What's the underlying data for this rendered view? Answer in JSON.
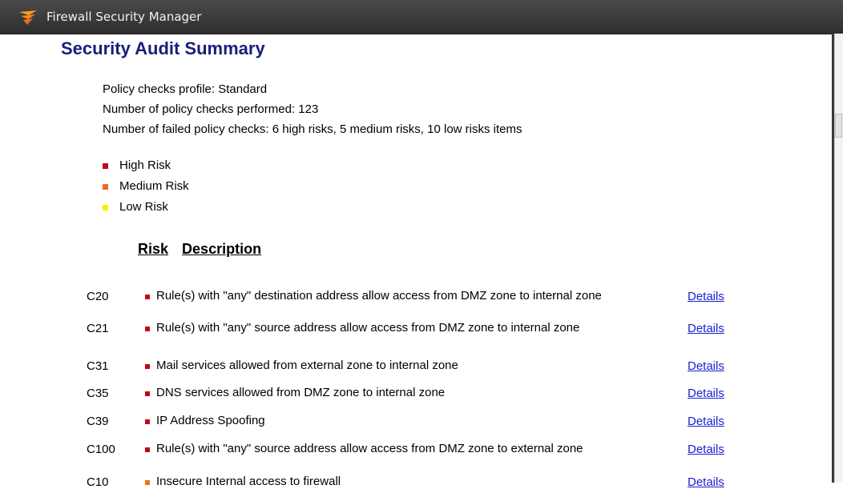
{
  "window": {
    "title": "Firewall Security Manager",
    "icon": "solarwinds-logo-icon"
  },
  "page": {
    "title": "Security Audit Summary"
  },
  "summary": {
    "profile": "Policy checks profile: Standard",
    "performed": "Number of policy checks performed: 123",
    "failed": "Number of failed policy checks: 6 high risks, 5 medium risks, 10 low risks items"
  },
  "legend": [
    {
      "label": "High Risk",
      "color": "#c0081b"
    },
    {
      "label": "Medium Risk",
      "color": "#f26b1d"
    },
    {
      "label": "Low Risk",
      "color": "#f5ef00"
    }
  ],
  "columns": {
    "risk": "Risk",
    "description": "Description"
  },
  "rows": [
    {
      "code": "C20",
      "desc": "Rule(s) with \"any\" destination address allow access from DMZ zone to internal zone",
      "level": "High Risk",
      "color": "#c0081b",
      "link": "Details"
    },
    {
      "code": "C21",
      "desc": "Rule(s) with \"any\" source address allow access from DMZ zone to internal zone",
      "level": "High Risk",
      "color": "#c0081b",
      "link": "Details"
    },
    {
      "code": "C31",
      "desc": "Mail services allowed from external zone to internal zone",
      "level": "High Risk",
      "color": "#c0081b",
      "link": "Details"
    },
    {
      "code": "C35",
      "desc": "DNS services allowed from DMZ zone to internal zone",
      "level": "High Risk",
      "color": "#c0081b",
      "link": "Details"
    },
    {
      "code": "C39",
      "desc": "IP Address Spoofing",
      "level": "High Risk",
      "color": "#c0081b",
      "link": "Details"
    },
    {
      "code": "C100",
      "desc": "Rule(s) with \"any\" source address allow access from DMZ zone to external zone",
      "level": "High Risk",
      "color": "#c0081b",
      "link": "Details"
    },
    {
      "code": "C10",
      "desc": "Insecure Internal access to firewall",
      "level": "Medium Risk",
      "color": "#f26b1d",
      "link": "Details"
    }
  ]
}
